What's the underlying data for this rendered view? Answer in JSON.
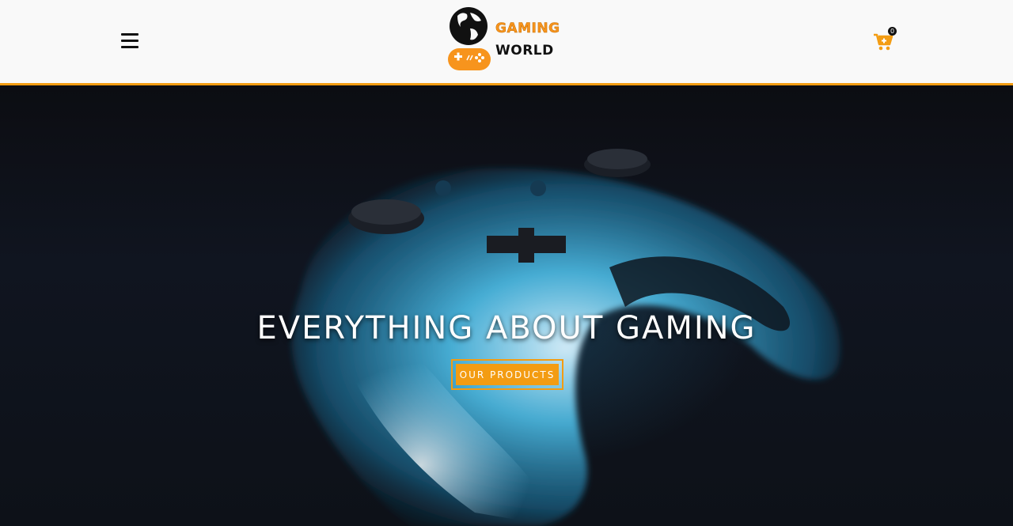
{
  "header": {
    "menu_icon": "hamburger-menu-icon",
    "logo": {
      "line1": "GAMING",
      "line2": "WORLD",
      "icon": "globe-controller-icon"
    },
    "cart": {
      "icon": "cart-plus-icon",
      "count": "0"
    }
  },
  "hero": {
    "title": "EVERYTHING ABOUT GAMING",
    "cta_label": "OUR PRODUCTS",
    "background": "glowing-game-controller-image"
  },
  "colors": {
    "accent": "#f39c12",
    "header_bg": "#f9f9f9",
    "hero_glow": "#2aa6d4"
  }
}
